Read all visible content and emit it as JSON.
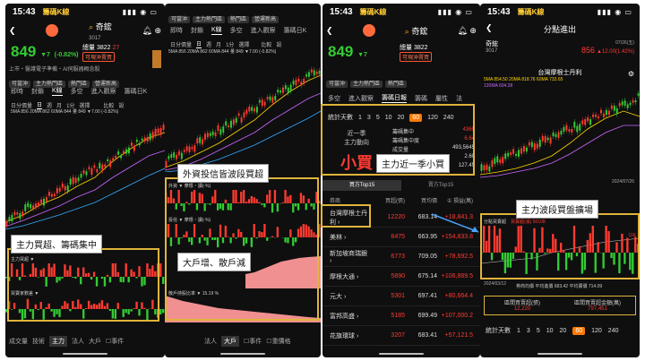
{
  "status": {
    "time": "15:43",
    "app": "籌碼K線"
  },
  "stock": {
    "name": "奇鋐",
    "code": "3017",
    "price": "849",
    "change": "▼7",
    "pct": "(-0.82%)",
    "volume_label": "總量",
    "volume": "3822",
    "amount": "27",
    "tag_warn": "可現沖賣買",
    "industry": "上市・醫護電子準備・AI伺服器概念股"
  },
  "chips": [
    "可當沖",
    "主力熱門區",
    "熱門區",
    "營運新高"
  ],
  "tabs1": [
    "即時",
    "封鎖",
    "K線",
    "多空",
    "進入觀察",
    "籌碼日K"
  ],
  "kbar": {
    "periods": [
      "日分價量",
      "日",
      "週",
      "月",
      "1分",
      "選擇"
    ],
    "ma": "5MA 856  20MA 862  60MA 844  量 849  ▼7.00 (-0.82%)",
    "extra": [
      "比較",
      "設"
    ]
  },
  "sub1": {
    "label1": "主力買超 ▼",
    "label2": "買賣家數差 ▼"
  },
  "annotations": {
    "a1": "主力買超、籌碼集中",
    "a2": "外資投信皆波段買超",
    "a3": "大戶增、散戶減",
    "a4": "主力近一季小買",
    "a5": "主力波段買盤擴場"
  },
  "p2": {
    "tabs": [
      "即時",
      "封鎖",
      "K線",
      "多空",
      "進入觀察",
      "籌碼日K"
    ],
    "sub_labels": [
      "外資",
      "投信",
      "散戶持股比率 ▼"
    ],
    "pct": "15.19 %",
    "bottom": [
      "成交量",
      "技術",
      "主力",
      "法人",
      "大戶"
    ],
    "bottom_sel": "大戶",
    "checks": [
      "事件",
      "重價格"
    ]
  },
  "p3": {
    "tabs": [
      "多空",
      "進入觀察",
      "籌碼日報",
      "籌碼",
      "屬性",
      "法"
    ],
    "period_label": "統計天數",
    "periods": [
      "1",
      "3",
      "5",
      "10",
      "20",
      "60",
      "120",
      "240"
    ],
    "period_sel": "60",
    "summary_left": "近一季",
    "summary_dir": "主力動向",
    "summary_big": "小買",
    "metrics": [
      {
        "k": "籌碼集中",
        "v": "4365"
      },
      {
        "k": "籌碼集中度",
        "v": "6.64"
      },
      {
        "k": "成交量",
        "v": "493,5645"
      },
      {
        "k": "集中比",
        "v": "2.60"
      },
      {
        "k": "週轉率",
        "v": "127.45"
      }
    ],
    "tab_buy": "買方Top15",
    "tab_sell": "賣方Top15",
    "headers": [
      "券商",
      "買超(張)",
      "買均價",
      "① 損益(萬)"
    ],
    "rows": [
      {
        "name": "台灣摩根士丹利",
        "qty": "12220",
        "price": "683.14",
        "pl": "+18,841.3"
      },
      {
        "name": "美林",
        "qty": "8475",
        "price": "663.95",
        "pl": "+154,833.8"
      },
      {
        "name": "新加坡商瑞銀",
        "qty": "6773",
        "price": "709.05",
        "pl": "+78,692.5"
      },
      {
        "name": "摩根大通",
        "qty": "5890",
        "price": "675.14",
        "pl": "+106,889.5"
      },
      {
        "name": "元大",
        "qty": "5301",
        "price": "697.41",
        "pl": "+80,664.4"
      },
      {
        "name": "富邦高盛",
        "qty": "5185",
        "price": "699.49",
        "pl": "+107,000.2"
      },
      {
        "name": "花旗環球",
        "qty": "3207",
        "price": "683.41",
        "pl": "+57,121.5"
      }
    ]
  },
  "p4": {
    "title": "分點進出",
    "stock_name": "奇鋐",
    "stock_code": "3017",
    "price": "856",
    "change": "▲12.00(1.42%)",
    "date_code": "07/26(五)",
    "broker": "台灣摩根士丹利",
    "ma_line": "5MA 854.50  20MA 818.76  60MA 733.65",
    "ma_line2": "120MA 604.38",
    "date_tag": "2024/07/26",
    "sub_label": "分點買賣超",
    "sub_value": "買賣超(張) 50108",
    "sub_tick": "11K",
    "date_range": "2024/03/12",
    "avg_label": "券商均價 平均進價 683.42  平均賣價 714.09",
    "total_buy_label": "區間買賣超(張)",
    "total_buy": "12,220",
    "total_amt_label": "區間買賣超金額(萬)",
    "total_amt": "797,451",
    "period_label": "統計天數",
    "periods": [
      "1",
      "3",
      "5",
      "10",
      "20",
      "60",
      "120",
      "240"
    ],
    "period_sel": "60"
  },
  "colors": {
    "up": "#ff3b30",
    "down": "#33cc33",
    "accent": "#ffb300",
    "hl": "#e0b43a"
  }
}
